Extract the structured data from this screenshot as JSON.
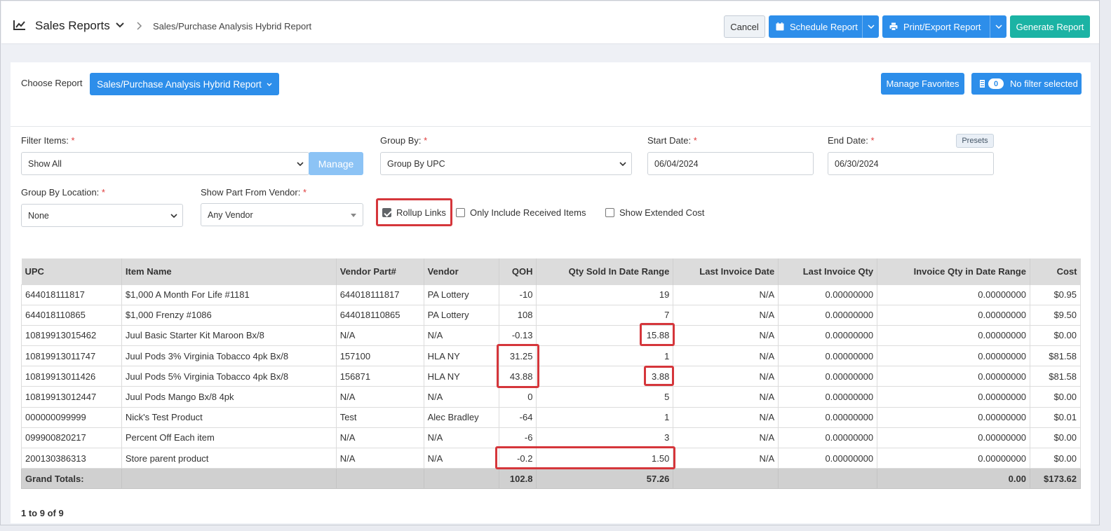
{
  "header": {
    "title": "Sales Reports",
    "breadcrumb": "Sales/Purchase Analysis Hybrid Report",
    "cancel_label": "Cancel",
    "schedule_label": "Schedule Report",
    "print_label": "Print/Export Report",
    "generate_label": "Generate Report"
  },
  "chooser": {
    "label": "Choose Report",
    "selected": "Sales/Purchase Analysis Hybrid Report",
    "manage_favorites": "Manage Favorites",
    "filter_count": "0",
    "filter_label": "No filter selected"
  },
  "filters": {
    "filter_items_label": "Filter Items:",
    "filter_items_value": "Show All",
    "manage_label": "Manage",
    "group_by_label": "Group By:",
    "group_by_value": "Group By UPC",
    "start_date_label": "Start Date:",
    "start_date_value": "06/04/2024",
    "end_date_label": "End Date:",
    "end_date_value": "06/30/2024",
    "presets_label": "Presets",
    "group_by_location_label": "Group By Location:",
    "group_by_location_value": "None",
    "vendor_label": "Show Part From Vendor:",
    "vendor_value": "Any Vendor",
    "required_mark": "*",
    "rollup_links": {
      "label": "Rollup Links",
      "checked": true
    },
    "only_received": {
      "label": "Only Include Received Items",
      "checked": false
    },
    "extended_cost": {
      "label": "Show Extended Cost",
      "checked": false
    }
  },
  "table": {
    "columns": [
      "UPC",
      "Item Name",
      "Vendor Part#",
      "Vendor",
      "QOH",
      "Qty Sold In Date Range",
      "Last Invoice Date",
      "Last Invoice Qty",
      "Invoice Qty in Date Range",
      "Cost"
    ],
    "rows": [
      [
        "644018111817",
        "$1,000 A Month For Life #1181",
        "644018111817",
        "PA Lottery",
        "-10",
        "19",
        "N/A",
        "0.00000000",
        "0.00000000",
        "$0.95"
      ],
      [
        "644018110865",
        "$1,000 Frenzy #1086",
        "644018110865",
        "PA Lottery",
        "108",
        "7",
        "N/A",
        "0.00000000",
        "0.00000000",
        "$9.50"
      ],
      [
        "10819913015462",
        "Juul Basic Starter Kit Maroon Bx/8",
        "N/A",
        "N/A",
        "-0.13",
        "15.88",
        "N/A",
        "0.00000000",
        "0.00000000",
        "$0.00"
      ],
      [
        "10819913011747",
        "Juul Pods 3% Virginia Tobacco 4pk Bx/8",
        "157100",
        "HLA NY",
        "31.25",
        "1",
        "N/A",
        "0.00000000",
        "0.00000000",
        "$81.58"
      ],
      [
        "10819913011426",
        "Juul Pods 5% Virginia Tobacco 4pk Bx/8",
        "156871",
        "HLA NY",
        "43.88",
        "3.88",
        "N/A",
        "0.00000000",
        "0.00000000",
        "$81.58"
      ],
      [
        "10819913012447",
        "Juul Pods Mango Bx/8 4pk",
        "N/A",
        "N/A",
        "0",
        "5",
        "N/A",
        "0.00000000",
        "0.00000000",
        "$0.00"
      ],
      [
        "000000099999",
        "Nick's Test Product",
        "Test",
        "Alec Bradley",
        "-64",
        "1",
        "N/A",
        "0.00000000",
        "0.00000000",
        "$0.01"
      ],
      [
        "099900820217",
        "Percent Off Each item",
        "N/A",
        "N/A",
        "-6",
        "3",
        "N/A",
        "0.00000000",
        "0.00000000",
        "$0.00"
      ],
      [
        "200130386313",
        "Store parent product",
        "N/A",
        "N/A",
        "-0.2",
        "1.50",
        "N/A",
        "0.00000000",
        "0.00000000",
        "$0.00"
      ]
    ],
    "totals": {
      "label": "Grand Totals:",
      "qoh": "102.8",
      "qty_sold": "57.26",
      "invoice_qty": "0.00",
      "cost": "$173.62"
    }
  },
  "pager": "1 to 9 of 9",
  "colors": {
    "primary": "#2d8eea",
    "teal": "#1bb3a4",
    "highlight": "#d5363b"
  }
}
